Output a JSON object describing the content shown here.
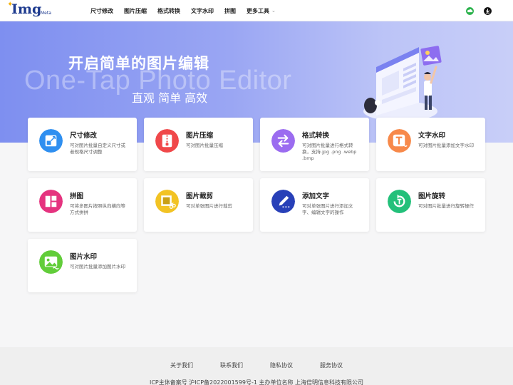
{
  "header": {
    "logo_text": "Img",
    "logo_sub": "Meta",
    "nav": [
      {
        "label": "尺寸修改"
      },
      {
        "label": "图片压缩"
      },
      {
        "label": "格式转换"
      },
      {
        "label": "文字水印"
      },
      {
        "label": "拼图"
      },
      {
        "label": "更多工具"
      }
    ]
  },
  "hero": {
    "title": "开启简单的图片编辑",
    "english": "One-Tap Photo Editor",
    "subtitle": "直观 简单 高效"
  },
  "tools": [
    {
      "title": "尺寸修改",
      "desc": "可对图片批量自定义尺寸或者规格尺寸调整",
      "color": "#2f8ff0",
      "icon": "resize-icon"
    },
    {
      "title": "图片压缩",
      "desc": "可对图片批量压缩",
      "color": "#f0484a",
      "icon": "zip-icon"
    },
    {
      "title": "格式转换",
      "desc": "可对图片批量进行格式转换，支持.jpg .png .webp .bmp",
      "color": "#9b6cf0",
      "icon": "swap-arrows-icon"
    },
    {
      "title": "文字水印",
      "desc": "可对图片批量添加文字水印",
      "color": "#f7894a",
      "icon": "text-watermark-icon"
    },
    {
      "title": "拼图",
      "desc": "可将多图片按照纵向横向等方式拼拼",
      "color": "#e5337f",
      "icon": "collage-icon"
    },
    {
      "title": "图片裁剪",
      "desc": "可对单张图片进行裁剪",
      "color": "#f2c324",
      "icon": "scissors-icon"
    },
    {
      "title": "添加文字",
      "desc": "可对单张图片进行添加文字、编辑文字的操作",
      "color": "#2840b8",
      "icon": "pen-icon"
    },
    {
      "title": "图片旋转",
      "desc": "可对图片批量进行旋转操作",
      "color": "#23c07a",
      "icon": "rotate-icon"
    },
    {
      "title": "图片水印",
      "desc": "可对图片批量添加图片水印",
      "color": "#62cd3a",
      "icon": "image-watermark-icon"
    }
  ],
  "footer": {
    "links": [
      "关于我们",
      "联系我们",
      "隐私协议",
      "服务协议"
    ],
    "icp": "ICP主体备案号 沪ICP备2022001599号-1 主办单位名称 上海倍明信息科技有限公司"
  }
}
